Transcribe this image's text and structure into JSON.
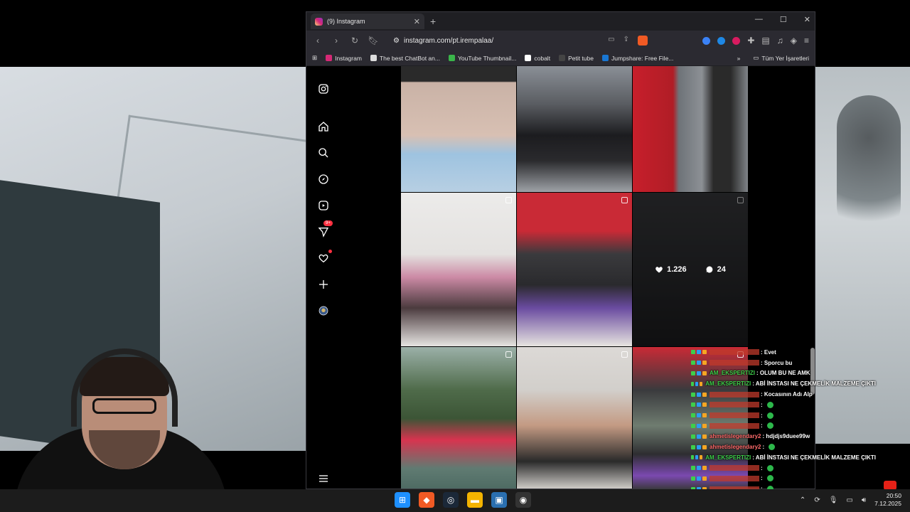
{
  "browser": {
    "tab_title": "(9) Instagram",
    "url": "instagram.com/pt.irempalaa/",
    "new_tab_symbol": "+",
    "bookmarks": [
      {
        "label": "Instagram",
        "color": "#d62976"
      },
      {
        "label": "The best ChatBot an...",
        "color": "#dddddd"
      },
      {
        "label": "YouTube Thumbnail...",
        "color": "#3ab54a"
      },
      {
        "label": "cobalt",
        "color": "#ffffff"
      },
      {
        "label": "Petit tube",
        "color": "#222222"
      },
      {
        "label": "Jumpshare: Free File...",
        "color": "#1976d2"
      }
    ],
    "all_bookmarks_label": "Tüm Yer İşaretleri"
  },
  "instagram": {
    "sidebar_icons": [
      "instagram-logo-icon",
      "home-icon",
      "search-icon",
      "explore-icon",
      "reels-icon",
      "messages-icon",
      "notifications-icon",
      "create-icon",
      "profile-icon",
      "menu-icon"
    ],
    "messages_badge": "9+",
    "hover_post": {
      "likes": "1.226",
      "comments": "24"
    }
  },
  "chat": [
    {
      "user": "",
      "message": ": Evet"
    },
    {
      "user": "",
      "message": ": Sporcu bu"
    },
    {
      "user": "AM_EKSPERTIZI",
      "message": ": OLUM BU NE AMK"
    },
    {
      "user": "AM_EKSPERTIZI",
      "message": ": ABİ İNSTASI NE ÇEKMELİK MALZEME ÇIKTI"
    },
    {
      "user": "",
      "message": ": Kocasının Adı Alp"
    },
    {
      "user": "",
      "message": ":"
    },
    {
      "user": "",
      "message": ":"
    },
    {
      "user": "",
      "message": ":"
    },
    {
      "user": "ahmetislegendary2",
      "message": ": hdjdjs9duee99w"
    },
    {
      "user": "ahmetislegendary2",
      "message": ":"
    },
    {
      "user": "AM_EKSPERTIZI",
      "message": ": ABİ İNSTASI NE ÇEKMELİK MALZEME ÇIKTI"
    },
    {
      "user": "",
      "message": ":"
    },
    {
      "user": "",
      "message": ":"
    },
    {
      "user": "",
      "message": ":"
    },
    {
      "user": "",
      "message": ":"
    }
  ],
  "taskbar": {
    "time": "20:50",
    "date": "7.12.2025"
  }
}
